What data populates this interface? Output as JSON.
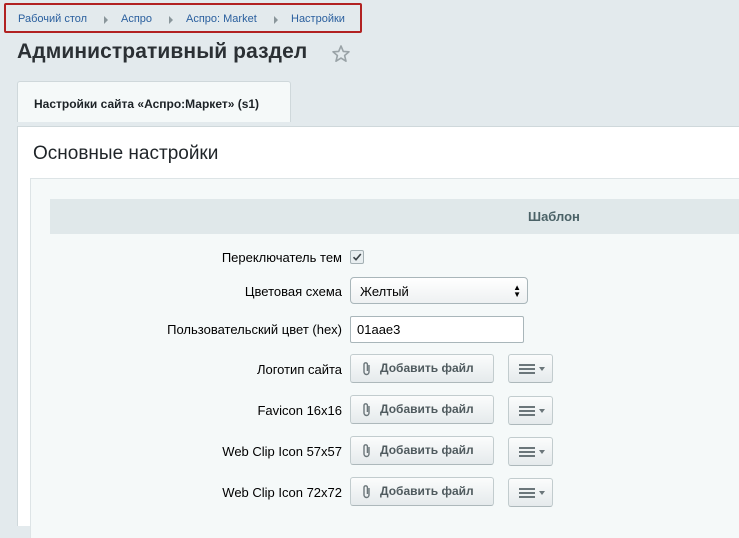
{
  "breadcrumb": [
    "Рабочий стол",
    "Аспро",
    "Аспро: Market",
    "Настройки"
  ],
  "page_title": "Административный раздел",
  "tab_label": "Настройки сайта «Аспро:Маркет» (s1)",
  "section_title": "Основные настройки",
  "group_label": "Шаблон",
  "fields": {
    "theme_switch": {
      "label": "Переключатель тем",
      "checked": true
    },
    "color_scheme": {
      "label": "Цветовая схема",
      "value": "Желтый"
    },
    "custom_color": {
      "label": "Пользовательский цвет (hex)",
      "value": "01aae3"
    },
    "files": [
      {
        "label": "Логотип сайта",
        "button": "Добавить файл"
      },
      {
        "label": "Favicon 16x16",
        "button": "Добавить файл"
      },
      {
        "label": "Web Clip Icon 57x57",
        "button": "Добавить файл"
      },
      {
        "label": "Web Clip Icon 72x72",
        "button": "Добавить файл"
      }
    ]
  },
  "colors": {
    "breadcrumb_link": "#2a5f9e",
    "highlight_border": "#b22222",
    "header_band": "#e0e8ea"
  }
}
